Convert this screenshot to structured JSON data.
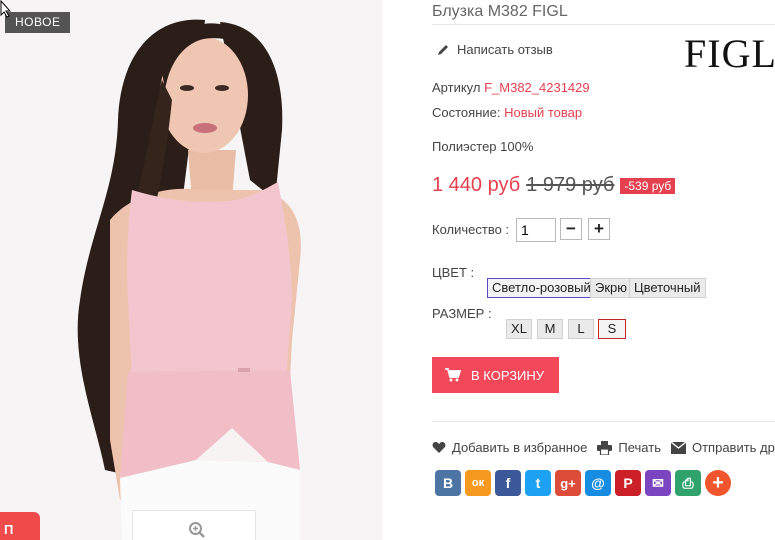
{
  "product": {
    "badge": "НОВОЕ",
    "title": "Блузка M382 FIGL",
    "brand_logo": "FIGL",
    "write_review": "Написать отзыв",
    "article_label": "Артикул",
    "article_value": "F_M382_4231429",
    "condition_label": "Состояние:",
    "condition_value": "Новый товар",
    "composition": "Полиэстер 100%",
    "price": "1 440 руб",
    "old_price": "1 979 руб",
    "discount": "-539 руб",
    "quantity_label": "Количество :",
    "quantity_value": "1",
    "quantity_minus": "−",
    "quantity_plus": "+",
    "color_label": "ЦВЕТ :",
    "colors": [
      "Светло-розовый",
      "Экрю",
      "Цветочный"
    ],
    "color_selected": "Светло-розовый",
    "size_label": "РАЗМЕР :",
    "sizes": [
      "XL",
      "M",
      "L",
      "S"
    ],
    "size_selected": "S",
    "cart_button": "В КОРЗИНУ"
  },
  "actions": {
    "favorite": "Добавить в избранное",
    "print": "Печать",
    "send": "Отправить дру"
  },
  "share": [
    {
      "icon": "vk-icon",
      "glyph": "В",
      "color": "#4c75a3"
    },
    {
      "icon": "odnoklassniki-icon",
      "glyph": "ок",
      "color": "#f59a1e"
    },
    {
      "icon": "facebook-icon",
      "glyph": "f",
      "color": "#3b5998"
    },
    {
      "icon": "twitter-icon",
      "glyph": "t",
      "color": "#1da1f2"
    },
    {
      "icon": "google-plus-icon",
      "glyph": "g+",
      "color": "#dd4b39"
    },
    {
      "icon": "mailru-icon",
      "glyph": "@",
      "color": "#168de2"
    },
    {
      "icon": "pinterest-icon",
      "glyph": "P",
      "color": "#cb2027"
    },
    {
      "icon": "email-icon",
      "glyph": "✉",
      "color": "#7b45c2"
    },
    {
      "icon": "print-icon",
      "glyph": "⎙",
      "color": "#2fa36b"
    },
    {
      "icon": "more-icon",
      "glyph": "+",
      "color": "#f0552d"
    }
  ],
  "colors": {
    "accent": "#e5404f",
    "cart": "#f2485a",
    "badge_bg": "#545454"
  },
  "left_tab": "П"
}
